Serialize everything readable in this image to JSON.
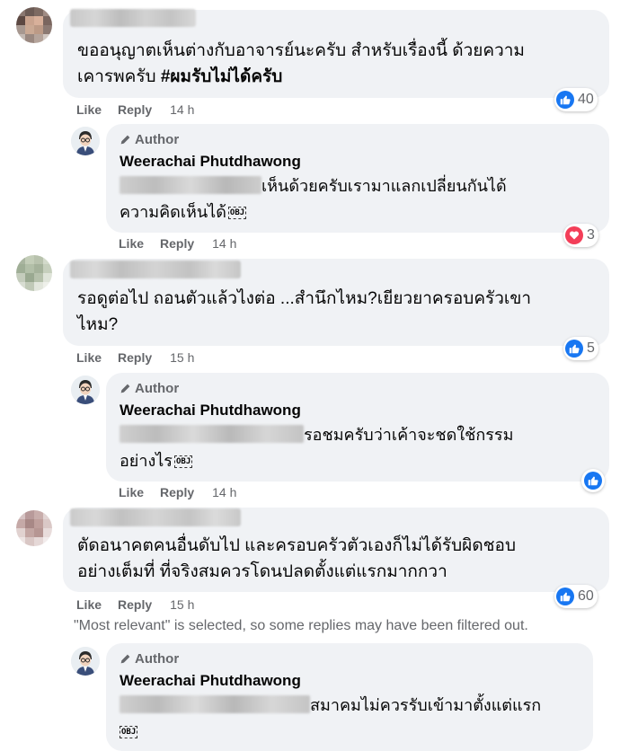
{
  "comments": [
    {
      "text_line1": "ขออนุญาตเห็นต่างกับอาจารย์นะครับ สำหรับเรื่องนี้ ด้วยความ",
      "text_line2_plain": "เคารพครับ ",
      "text_line2_bold": "#ผมรับไม่ได้ครับ",
      "like": "Like",
      "reply": "Reply",
      "time": "14 h",
      "reaction_count": "40",
      "reaction_type": "like"
    },
    {
      "text_line1": "รอดูต่อไป ถอนตัวแล้วไงต่อ ...สำนึกไหม?เยียวยาครอบครัวเขา",
      "text_line2": "ไหม?",
      "like": "Like",
      "reply": "Reply",
      "time": "15 h",
      "reaction_count": "5",
      "reaction_type": "like"
    },
    {
      "text_line1": "ตัดอนาคตคนอื่นดับไป และครอบครัวตัวเองก็ไม่ได้รับผิดชอบ",
      "text_line2": "อย่างเต็มที่ ที่จริงสมควรโดนปลดตั้งแต่แรกมากกวา",
      "like": "Like",
      "reply": "Reply",
      "time": "15 h",
      "reaction_count": "60",
      "reaction_type": "like"
    }
  ],
  "replies": [
    {
      "author_label": "Author",
      "author_name": "Weerachai Phutdhawong",
      "text_line1": "เห็นด้วยครับเรามาแลกเปลี่ยนกันได้",
      "text_line2": "ความคิดเห็นได้",
      "obj": "OBJ",
      "like": "Like",
      "reply": "Reply",
      "time": "14 h",
      "reaction_count": "3",
      "reaction_type": "love"
    },
    {
      "author_label": "Author",
      "author_name": "Weerachai Phutdhawong",
      "text_line1": "รอชมครับว่าเค้าจะชดใช้กรรม",
      "text_line2": "อย่างไร",
      "obj": "OBJ",
      "like": "Like",
      "reply": "Reply",
      "time": "14 h",
      "reaction_count": "",
      "reaction_type": "like"
    },
    {
      "author_label": "Author",
      "author_name": "Weerachai Phutdhawong",
      "text_line1": "สมาคมไม่ควรรับเข้ามาตั้งแต่แรก",
      "obj": "OBJ"
    }
  ],
  "filter_note": "\"Most relevant\" is selected, so some replies may have been filtered out.",
  "colors": {
    "bubble": "#f0f2f5",
    "like_blue": "#1877f2",
    "love_red": "#f33e58",
    "meta_gray": "#65676b"
  }
}
